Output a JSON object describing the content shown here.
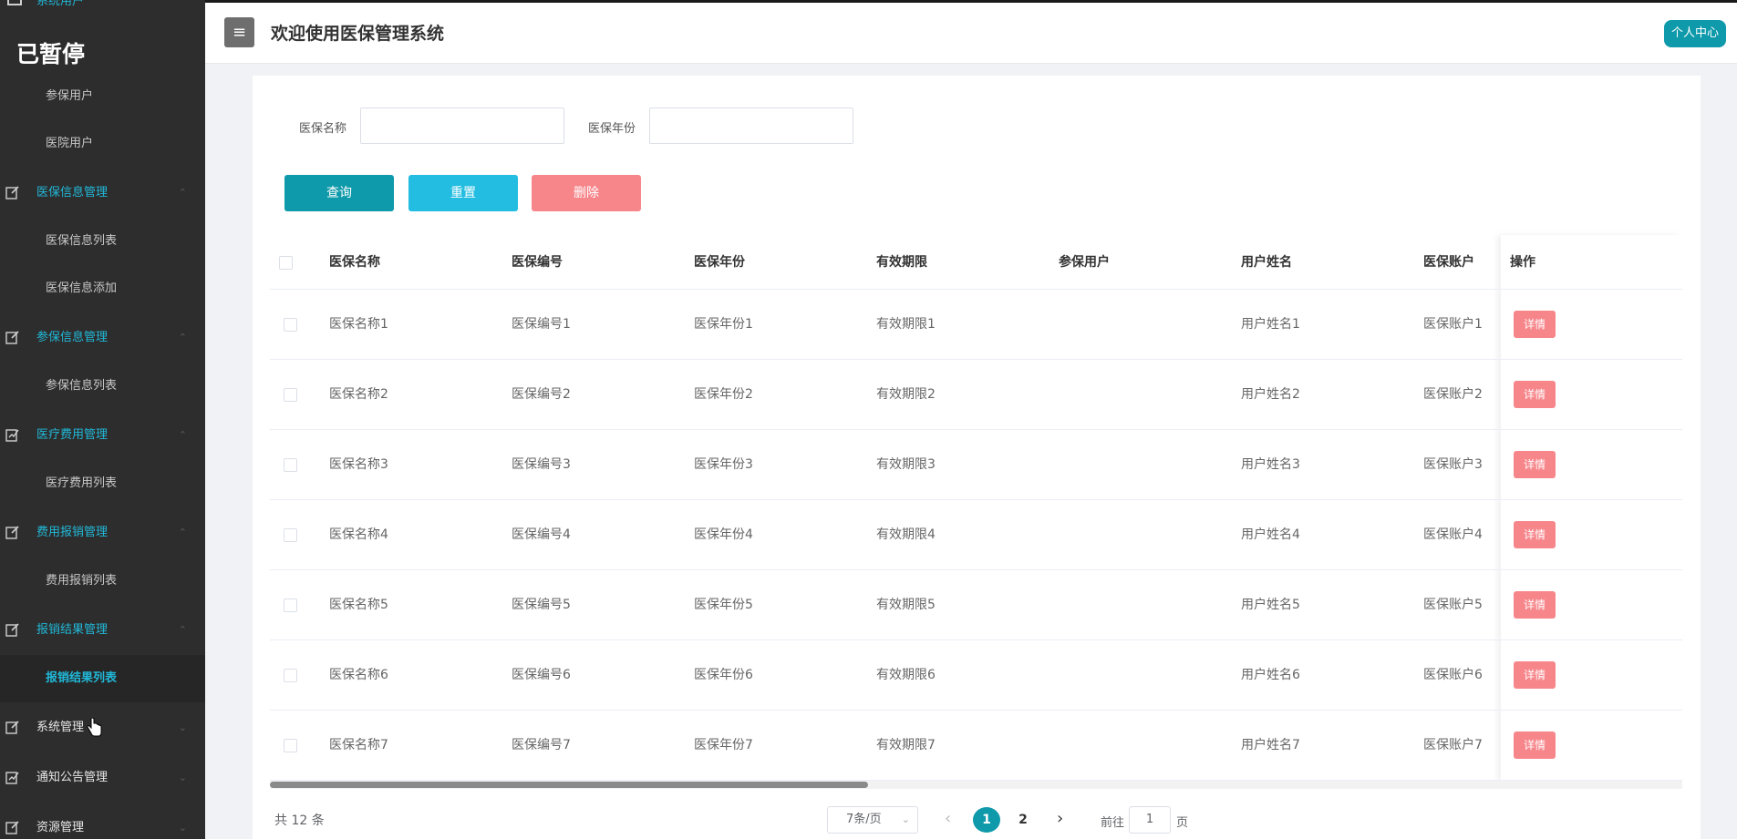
{
  "sidebar": {
    "cut_item": "系统用户",
    "paused_label": "已暂停",
    "items": [
      {
        "type": "sub",
        "label": "参保用户"
      },
      {
        "type": "sub",
        "label": "医院用户"
      },
      {
        "type": "group",
        "label": "医保信息管理",
        "icon": "edit-icon"
      },
      {
        "type": "sub",
        "label": "医保信息列表"
      },
      {
        "type": "sub",
        "label": "医保信息添加"
      },
      {
        "type": "group",
        "label": "参保信息管理",
        "icon": "edit-icon"
      },
      {
        "type": "sub",
        "label": "参保信息列表"
      },
      {
        "type": "group",
        "label": "医疗费用管理",
        "icon": "chart-icon"
      },
      {
        "type": "sub",
        "label": "医疗费用列表"
      },
      {
        "type": "group",
        "label": "费用报销管理",
        "icon": "edit-icon"
      },
      {
        "type": "sub",
        "label": "费用报销列表"
      },
      {
        "type": "group",
        "label": "报销结果管理",
        "icon": "edit-icon"
      },
      {
        "type": "sub",
        "label": "报销结果列表",
        "active": true
      },
      {
        "type": "group",
        "label": "系统管理",
        "icon": "edit-icon",
        "white": true
      },
      {
        "type": "group",
        "label": "通知公告管理",
        "icon": "chart-icon",
        "white": true
      },
      {
        "type": "group",
        "label": "资源管理",
        "icon": "edit-icon",
        "white": true
      }
    ]
  },
  "header": {
    "menu_icon": "≡",
    "title": "欢迎使用医保管理系统",
    "personal_center": "个人中心"
  },
  "search": {
    "name_label": "医保名称",
    "name_value": "",
    "year_label": "医保年份",
    "year_value": ""
  },
  "actions": {
    "query": "查询",
    "reset": "重置",
    "delete": "删除"
  },
  "table": {
    "columns": [
      "医保名称",
      "医保编号",
      "医保年份",
      "有效期限",
      "参保用户",
      "用户姓名",
      "医保账户",
      "操作"
    ],
    "detail_label": "详情",
    "rows": [
      [
        "医保名称1",
        "医保编号1",
        "医保年份1",
        "有效期限1",
        "",
        "用户姓名1",
        "医保账户1"
      ],
      [
        "医保名称2",
        "医保编号2",
        "医保年份2",
        "有效期限2",
        "",
        "用户姓名2",
        "医保账户2"
      ],
      [
        "医保名称3",
        "医保编号3",
        "医保年份3",
        "有效期限3",
        "",
        "用户姓名3",
        "医保账户3"
      ],
      [
        "医保名称4",
        "医保编号4",
        "医保年份4",
        "有效期限4",
        "",
        "用户姓名4",
        "医保账户4"
      ],
      [
        "医保名称5",
        "医保编号5",
        "医保年份5",
        "有效期限5",
        "",
        "用户姓名5",
        "医保账户5"
      ],
      [
        "医保名称6",
        "医保编号6",
        "医保年份6",
        "有效期限6",
        "",
        "用户姓名6",
        "医保账户6"
      ],
      [
        "医保名称7",
        "医保编号7",
        "医保年份7",
        "有效期限7",
        "",
        "用户姓名7",
        "医保账户7"
      ]
    ]
  },
  "pagination": {
    "total": "共 12 条",
    "page_size": "7条/页",
    "prev": "‹",
    "pages": [
      "1",
      "2"
    ],
    "current_page": "1",
    "next": "›",
    "goto_label": "前往",
    "goto_value": "1",
    "goto_suffix": "页"
  },
  "colors": {
    "accent": "#21b8d8",
    "query": "#0e9aaa",
    "reset": "#22bde0",
    "delete": "#f7868b",
    "sidebar_bg": "#2d2d2d"
  }
}
